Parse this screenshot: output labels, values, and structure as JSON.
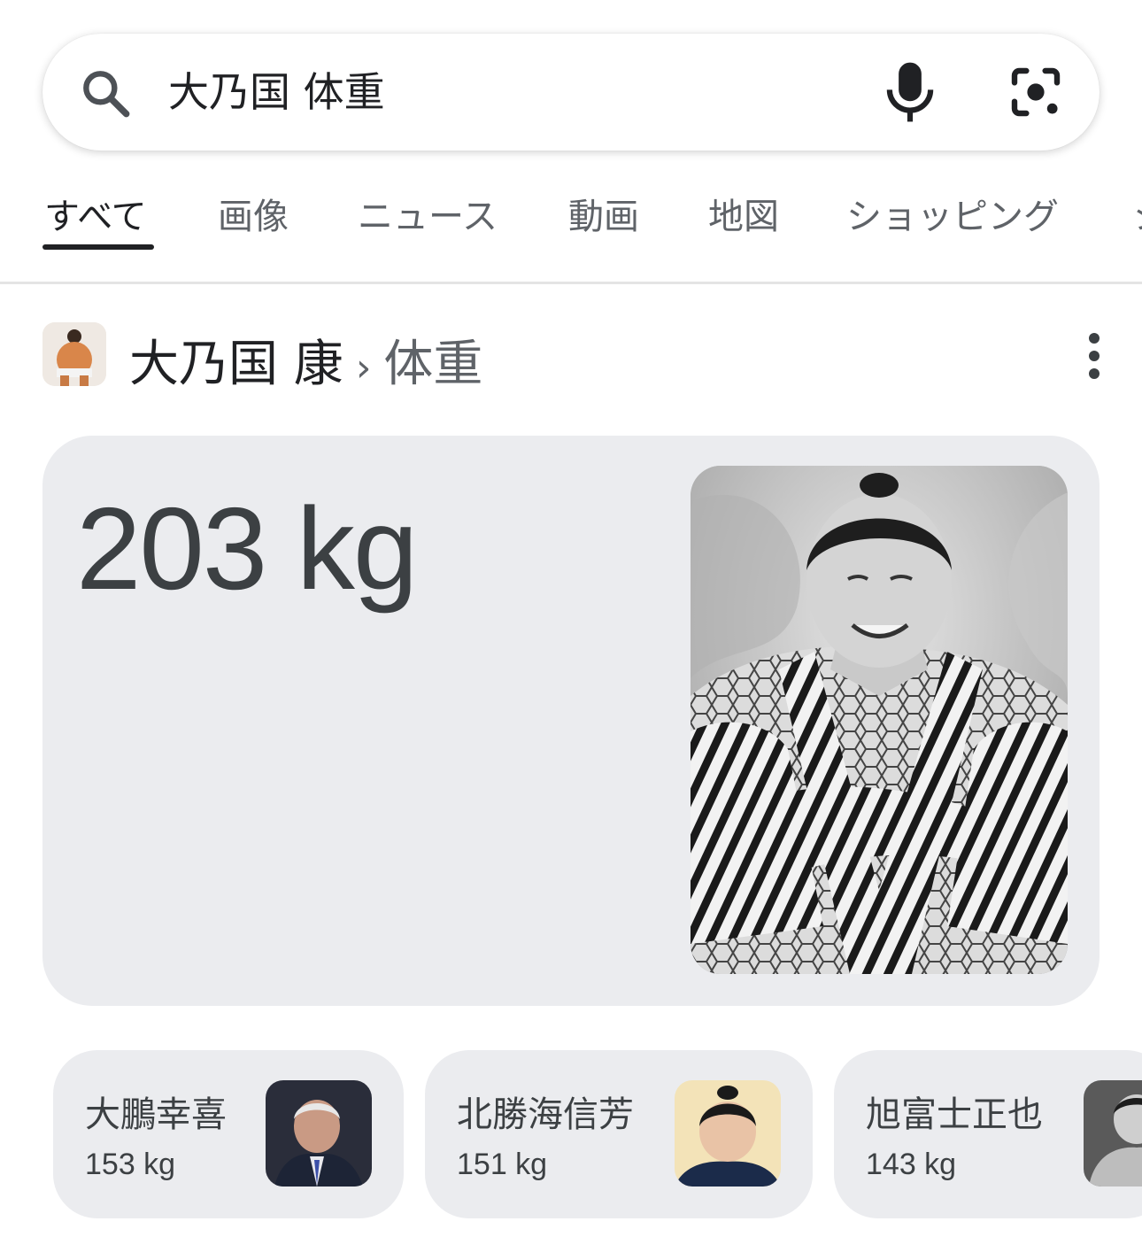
{
  "search": {
    "query": "大乃国 体重"
  },
  "tabs": [
    {
      "label": "すべて",
      "active": true
    },
    {
      "label": "画像"
    },
    {
      "label": "ニュース"
    },
    {
      "label": "動画"
    },
    {
      "label": "地図"
    },
    {
      "label": "ショッピング"
    },
    {
      "label": "シ"
    }
  ],
  "entity": {
    "name": "大乃国 康",
    "separator": "›",
    "attribute": "体重"
  },
  "answer": {
    "value": "203 kg"
  },
  "related": [
    {
      "name": "大鵬幸喜",
      "weight": "153 kg"
    },
    {
      "name": "北勝海信芳",
      "weight": "151 kg"
    },
    {
      "name": "旭富士正也",
      "weight": "143 kg"
    }
  ],
  "colors": {
    "card_bg": "#ebecef",
    "active_tab": "#202124",
    "inactive_tab": "#5f6368"
  },
  "icons": [
    "search-icon",
    "microphone-icon",
    "camera-lens-icon",
    "more-vert-icon"
  ]
}
